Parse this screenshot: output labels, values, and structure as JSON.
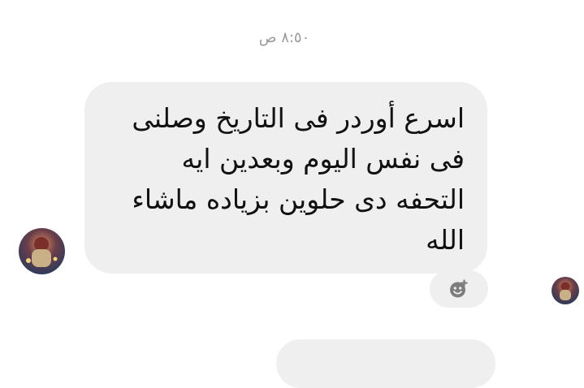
{
  "chat": {
    "timestamp": "٨:٥٠ ص",
    "message": {
      "text": "اسرع أوردر فى التاريخ وصلنى\nفى نفس اليوم وبعدين ايه\nالتحفه دى حلوين بزياده ماشاء\nالله"
    },
    "icons": {
      "add_reaction": "add-reaction-icon",
      "sender_avatar": "avatar-image",
      "seen_avatar": "avatar-image"
    },
    "colors": {
      "bubble": "#efefef",
      "text": "#111111",
      "timestamp": "#9a9a9a",
      "background": "#ffffff"
    }
  }
}
